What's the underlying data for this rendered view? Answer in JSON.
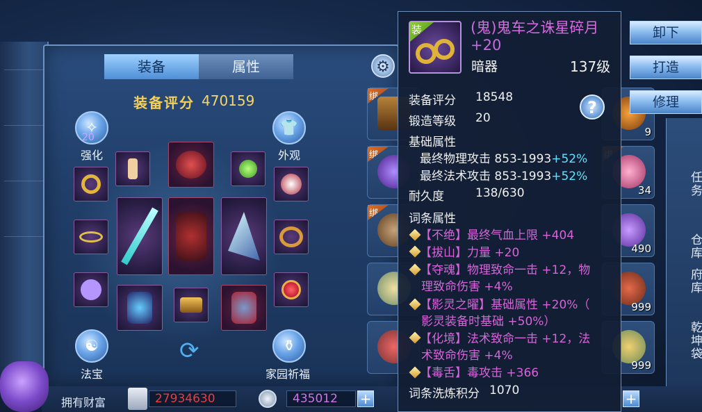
{
  "equip_panel": {
    "tabs": [
      "装备",
      "属性"
    ],
    "score_label": "装备评分",
    "score_value": "470159",
    "enhance_label": "强化",
    "enhance_level": "20",
    "appearance_label": "外观",
    "treasure_label": "法宝",
    "blessing_label": "家园祈福"
  },
  "bag": {
    "bind_label": "绑",
    "counts": [
      "9",
      "34",
      "490",
      "999",
      "999"
    ]
  },
  "right_menu": {
    "items": [
      "任务",
      "仓库",
      "府库",
      "乾坤袋"
    ]
  },
  "actions": {
    "unequip": "卸下",
    "forge": "打造",
    "repair": "修理"
  },
  "wealth": {
    "label": "拥有财富",
    "gold": "27934630",
    "coins": "435012",
    "plus": "+"
  },
  "tooltip": {
    "equip_badge": "装",
    "name_prefix": "(鬼)鬼车之诛星碎月",
    "name_plus": " +20",
    "type": "暗器",
    "level": "137级",
    "score_label": "装备评分",
    "score_value": "18548",
    "forge_label": "锻造等级",
    "forge_value": "20",
    "base_label": "基础属性",
    "phys_attack": "最终物理攻击 853-1993",
    "phys_bonus": "+52%",
    "magic_attack": "最终法术攻击 853-1993",
    "magic_bonus": "+52%",
    "durability_label": "耐久度",
    "durability_value": "138/630",
    "affix_label": "词条属性",
    "affixes": [
      "【不绝】最终气血上限 +404",
      "【拔山】力量 +20",
      "【夺魂】物理致命一击 +12，物",
      "理致命伤害 +4%",
      "【影灵之曜】基础属性 +20%（",
      "影灵装备时基础 +50%）",
      "【化境】法术致命一击 +12，法",
      "术致命伤害 +4%",
      "【毒舌】毒攻击 +366"
    ],
    "refine_label": "词条洗炼积分",
    "refine_value": "1070",
    "help": "?"
  },
  "icons": [
    "gear-icon",
    "refresh-icon",
    "help-icon",
    "coin-icon",
    "money-icon",
    "bag-icon"
  ],
  "colors": {
    "affix_pink": "#d565d8",
    "bonus_cyan": "#5fe3ff",
    "score_gold": "#f6cf57"
  }
}
